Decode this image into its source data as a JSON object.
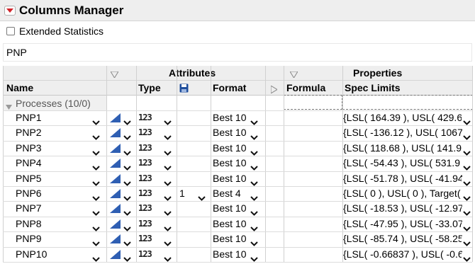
{
  "header": {
    "title": "Columns Manager"
  },
  "options": {
    "extended_statistics_label": "Extended Statistics",
    "extended_statistics_checked": false
  },
  "filter": {
    "value": "PNP"
  },
  "table": {
    "group_headers": {
      "attributes": "Attributes",
      "properties": "Properties"
    },
    "columns": {
      "name": "Name",
      "type": "Type",
      "format": "Format",
      "formula": "Formula",
      "spec_limits": "Spec Limits"
    },
    "group_row": {
      "label": "Processes (10/0)"
    },
    "rows": [
      {
        "name": "PNP1",
        "type_icon": "123",
        "width": "",
        "format": "Best 10",
        "spec_limits": "{LSL( 164.39 ), USL( 429.6"
      },
      {
        "name": "PNP2",
        "type_icon": "123",
        "width": "",
        "format": "Best 10",
        "spec_limits": "{LSL( -136.12 ), USL( 1067"
      },
      {
        "name": "PNP3",
        "type_icon": "123",
        "width": "",
        "format": "Best 10",
        "spec_limits": "{LSL( 118.68 ), USL( 141.9"
      },
      {
        "name": "PNP4",
        "type_icon": "123",
        "width": "",
        "format": "Best 10",
        "spec_limits": "{LSL( -54.43 ), USL( 531.9"
      },
      {
        "name": "PNP5",
        "type_icon": "123",
        "width": "",
        "format": "Best 10",
        "spec_limits": "{LSL( -51.78 ), USL( -41.94"
      },
      {
        "name": "PNP6",
        "type_icon": "123",
        "width": "1",
        "format": "Best 4",
        "spec_limits": "{LSL( 0 ), USL( 0 ), Target("
      },
      {
        "name": "PNP7",
        "type_icon": "123",
        "width": "",
        "format": "Best 10",
        "spec_limits": "{LSL( -18.53 ), USL( -12.97"
      },
      {
        "name": "PNP8",
        "type_icon": "123",
        "width": "",
        "format": "Best 10",
        "spec_limits": "{LSL( -47.95 ), USL( -33.07"
      },
      {
        "name": "PNP9",
        "type_icon": "123",
        "width": "",
        "format": "Best 10",
        "spec_limits": "{LSL( -85.74 ), USL( -58.25"
      },
      {
        "name": "PNP10",
        "type_icon": "123",
        "width": "",
        "format": "Best 10",
        "spec_limits": "{LSL( -0.66837 ), USL( -0.6"
      }
    ]
  },
  "colors": {
    "accent_red": "#d0232a",
    "model_blue": "#2f5fb3",
    "header_bg": "#eeeeee"
  }
}
